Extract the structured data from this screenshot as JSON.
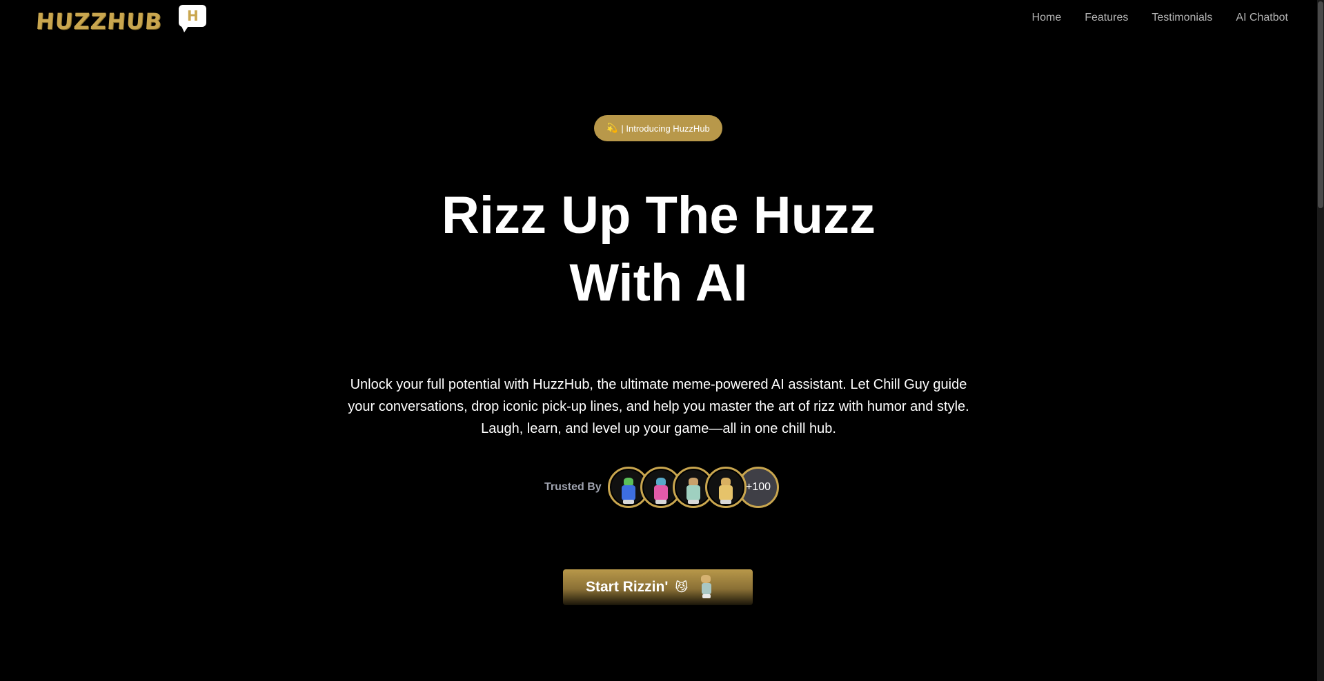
{
  "nav": {
    "logo_text": "HUZZHUB",
    "logo_bubble_letter": "H",
    "links": [
      "Home",
      "Features",
      "Testimonials",
      "AI Chatbot"
    ]
  },
  "badge": {
    "emoji": "💫",
    "text": "| Introducing HuzzHub"
  },
  "hero": {
    "headline_line1": "Rizz Up The Huzz",
    "headline_line2": "With AI",
    "description": "Unlock your full potential with HuzzHub, the ultimate meme-powered AI assistant. Let Chill Guy guide your conversations, drop iconic pick-up lines, and help you master the art of rizz with humor and style. Laugh, learn, and level up your game—all in one chill hub."
  },
  "trusted": {
    "label": "Trusted By",
    "more_count": "+100",
    "avatars": [
      {
        "name": "chill-guy-green",
        "head": "#5bbf5a",
        "body": "#3d6ee0"
      },
      {
        "name": "chill-guy-blue",
        "head": "#58a9c9",
        "body": "#e25aa8"
      },
      {
        "name": "chill-guy-dark",
        "head": "#c9a06a",
        "body": "#9fd0c0"
      },
      {
        "name": "chill-guy-tan",
        "head": "#d9b061",
        "body": "#e6c36a"
      }
    ]
  },
  "cta": {
    "label": "Start Rizzin'",
    "emoji": "😼"
  },
  "colors": {
    "accent": "#c9a64f",
    "background": "#000000"
  }
}
